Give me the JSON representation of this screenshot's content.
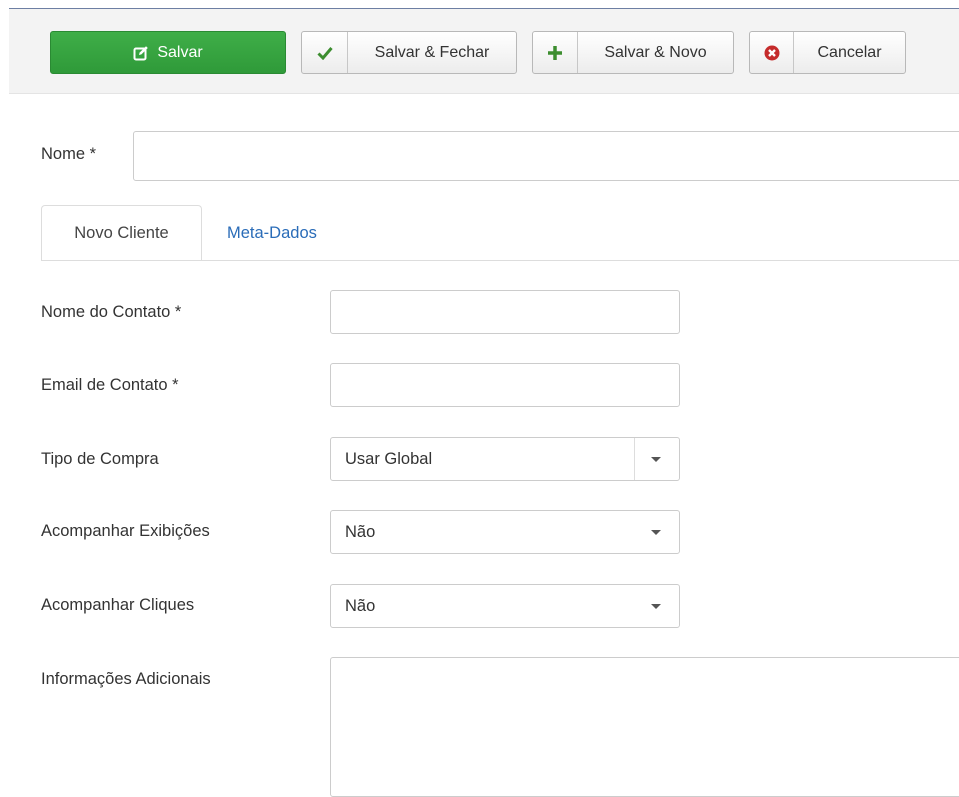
{
  "toolbar": {
    "save": "Salvar",
    "save_close": "Salvar & Fechar",
    "save_new": "Salvar & Novo",
    "cancel": "Cancelar"
  },
  "form": {
    "name_label": "Nome *",
    "name_value": ""
  },
  "tabs": [
    {
      "label": "Novo Cliente",
      "active": true
    },
    {
      "label": "Meta-Dados",
      "active": false
    }
  ],
  "fields": {
    "contact_name_label": "Nome do Contato *",
    "contact_name_value": "",
    "contact_email_label": "Email de Contato *",
    "contact_email_value": "",
    "purchase_type_label": "Tipo de Compra",
    "purchase_type_value": "Usar Global",
    "track_impressions_label": "Acompanhar Exibições",
    "track_impressions_value": "Não",
    "track_clicks_label": "Acompanhar Cliques",
    "track_clicks_value": "Não",
    "extra_info_label": "Informações Adicionais",
    "extra_info_value": ""
  },
  "icons": {
    "save": "edit-icon",
    "save_close": "check-icon",
    "save_new": "plus-icon",
    "cancel": "cancel-circle-icon"
  },
  "colors": {
    "save_button": "#34a03e",
    "check": "#3c8d2f",
    "plus": "#3c8d2f",
    "cancel": "#c52b2b",
    "link": "#2a6cb8"
  }
}
